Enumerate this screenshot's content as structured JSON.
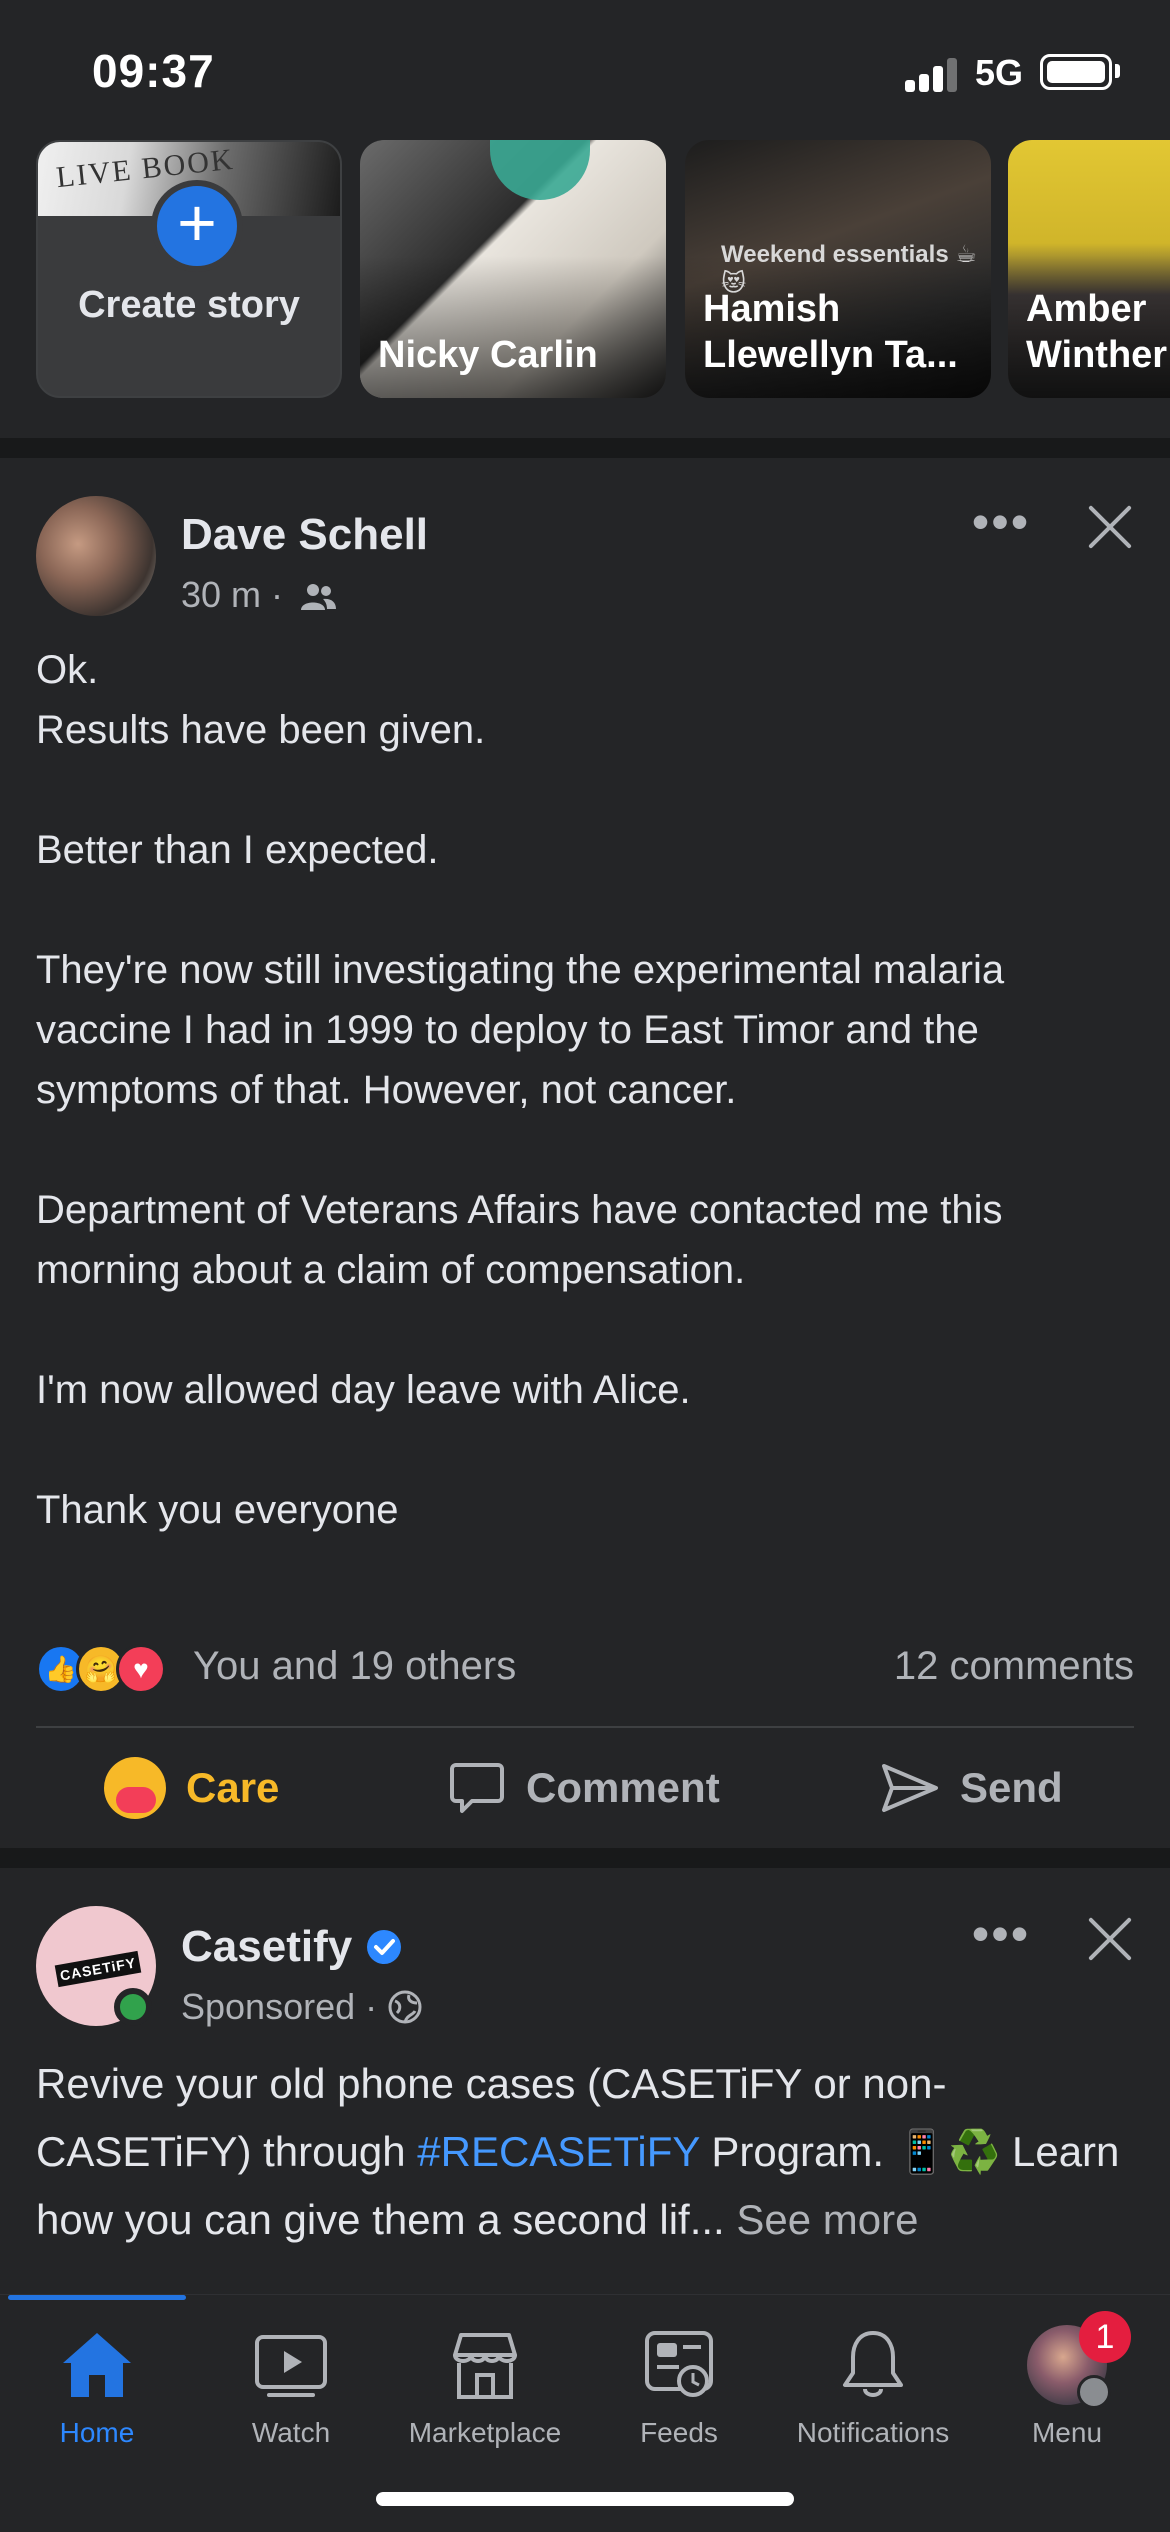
{
  "status_bar": {
    "time": "09:37",
    "network": "5G"
  },
  "stories": [
    {
      "type": "create",
      "label": "Create story",
      "image_text": "LIVE BOOK"
    },
    {
      "type": "friend",
      "name": "Nicky Carlin"
    },
    {
      "type": "friend",
      "name": "Hamish Llewellyn Ta...",
      "overlay_text": "Weekend essentials ☕😻"
    },
    {
      "type": "friend",
      "name": "Amber Winther"
    }
  ],
  "post": {
    "author": "Dave Schell",
    "time": "30 m",
    "audience_icon": "friends-icon",
    "paragraphs": [
      "Ok.",
      "Results have been given.",
      "",
      "Better than I expected.",
      "",
      "They're now still investigating the experimental malaria vaccine I had in 1999 to deploy to East Timor and the symptoms of that. However,  not cancer.",
      "",
      "Department of Veterans Affairs have contacted me this morning about a claim of compensation.",
      "",
      "I'm now allowed day leave with Alice.",
      "",
      "Thank you everyone"
    ],
    "reactions_text": "You and 19 others",
    "comments_text": "12 comments",
    "actions": {
      "care": "Care",
      "comment": "Comment",
      "send": "Send"
    },
    "reaction_icons": [
      "like-icon",
      "care-icon",
      "love-icon"
    ]
  },
  "sponsored_post": {
    "author": "Casetify",
    "logo_text": "CASETiFY",
    "meta": "Sponsored",
    "body_before": "Revive your old phone cases (CASETiFY or non-CASETiFY) through ",
    "hashtag": "#RECASETiFY",
    "body_after": " Program. 📱♻️ Learn how you can give them a second lif...",
    "see_more": "See more"
  },
  "tab_bar": {
    "tabs": [
      {
        "label": "Home",
        "icon": "home-icon",
        "active": true
      },
      {
        "label": "Watch",
        "icon": "watch-icon",
        "active": false
      },
      {
        "label": "Marketplace",
        "icon": "marketplace-icon",
        "active": false
      },
      {
        "label": "Feeds",
        "icon": "feeds-icon",
        "active": false
      },
      {
        "label": "Notifications",
        "icon": "bell-icon",
        "active": false
      },
      {
        "label": "Menu",
        "icon": "menu-avatar",
        "active": false,
        "badge": "1"
      }
    ]
  },
  "colors": {
    "background": "#242527",
    "accent": "#2374e1",
    "care": "#f7b928",
    "hashtag": "#4599ff",
    "badge": "#e41e3f"
  }
}
